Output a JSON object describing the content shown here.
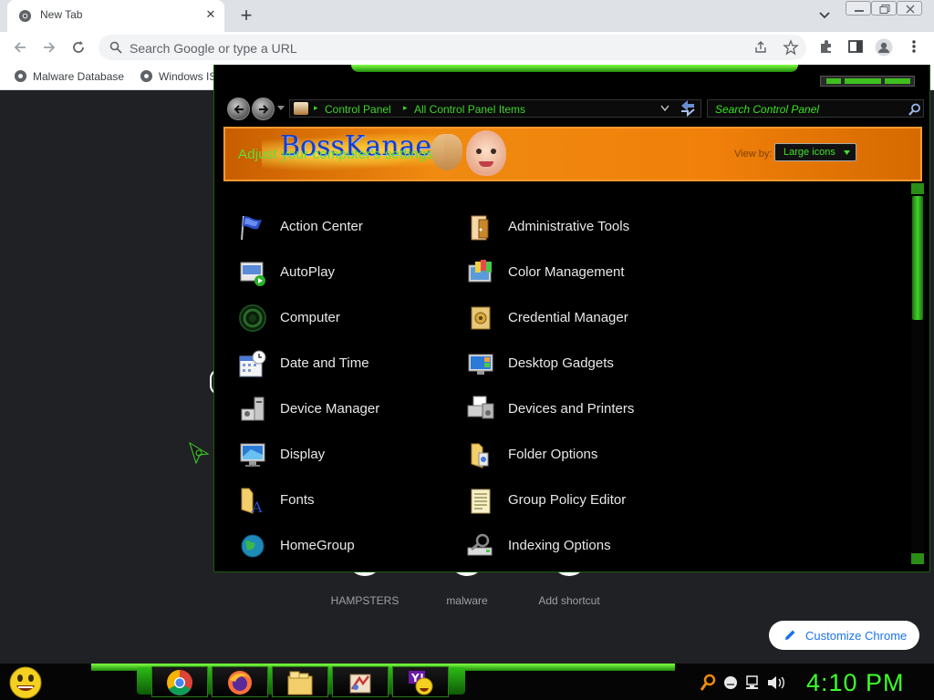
{
  "browser": {
    "tab_title": "New Tab",
    "tab_close": "✕",
    "new_tab": "+",
    "omnibox_placeholder": "Search Google or type a URL",
    "bookmarks": [
      {
        "label": "Malware Database"
      },
      {
        "label": "Windows IS"
      }
    ]
  },
  "newtab_page": {
    "shortcuts": [
      {
        "label": "HAMPSTERS"
      },
      {
        "label": "malware"
      },
      {
        "label": "Add shortcut"
      }
    ],
    "customize_label": "Customize Chrome"
  },
  "control_panel": {
    "breadcrumb": [
      "Control Panel",
      "All Control Panel Items"
    ],
    "search_placeholder": "Search Control Panel",
    "banner_logo_text": "BossKanae",
    "banner_heading": "Adjust your computer's settings",
    "view_by_label": "View by:",
    "view_by_value": "Large icons",
    "items": [
      {
        "label": "Action Center",
        "icon": "flag-icon"
      },
      {
        "label": "Administrative Tools",
        "icon": "admin-tools-icon"
      },
      {
        "label": "AutoPlay",
        "icon": "autoplay-icon"
      },
      {
        "label": "Color Management",
        "icon": "color-management-icon"
      },
      {
        "label": "Computer",
        "icon": "computer-icon"
      },
      {
        "label": "Credential Manager",
        "icon": "credential-vault-icon"
      },
      {
        "label": "Date and Time",
        "icon": "calendar-clock-icon"
      },
      {
        "label": "Desktop Gadgets",
        "icon": "desktop-gadgets-icon"
      },
      {
        "label": "Device Manager",
        "icon": "device-manager-icon"
      },
      {
        "label": "Devices and Printers",
        "icon": "printer-icon"
      },
      {
        "label": "Display",
        "icon": "monitor-icon"
      },
      {
        "label": "Folder Options",
        "icon": "folder-options-icon"
      },
      {
        "label": "Fonts",
        "icon": "fonts-folder-icon"
      },
      {
        "label": "Group Policy Editor",
        "icon": "policy-document-icon"
      },
      {
        "label": "HomeGroup",
        "icon": "globe-icon"
      },
      {
        "label": "Indexing Options",
        "icon": "indexing-icon"
      }
    ]
  },
  "taskbar": {
    "apps": [
      "chrome-icon",
      "firefox-icon",
      "explorer-folder-icon",
      "control-panel-icon",
      "yahoo-messenger-icon"
    ],
    "clock": "4:10 PM",
    "accent_color": "#3cff2a"
  }
}
